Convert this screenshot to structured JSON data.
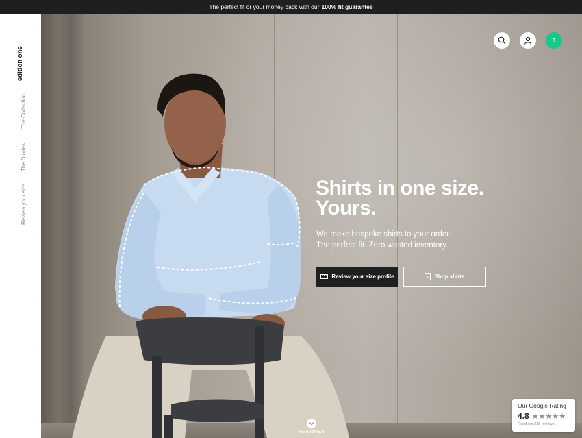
{
  "announcement": {
    "text": "The perfect fit or your money back with our",
    "link": "100% fit guarantee"
  },
  "sidebar": {
    "brand": "edition one",
    "items": [
      {
        "label": "The Collection"
      },
      {
        "label": "The Stories"
      },
      {
        "label": "Review your size"
      }
    ]
  },
  "header_icons": {
    "search": "search-icon",
    "account": "user-icon",
    "cart_count": "0"
  },
  "hero": {
    "headline_line1": "Shirts in one size.",
    "headline_line2": "Yours.",
    "sub_line1": "We make bespoke shirts to your order.",
    "sub_line2": "The perfect fit. Zero wasted inventory.",
    "primary_button": "Review your size profile",
    "secondary_button": "Shop shirts",
    "scroll_label": "Scroll Down"
  },
  "rating": {
    "title": "Our Google Rating",
    "score": "4.8",
    "stars": "★★★★★",
    "link": "Read our 238 reviews"
  },
  "colors": {
    "accent": "#17c98a",
    "dark": "#1f1f1f"
  }
}
